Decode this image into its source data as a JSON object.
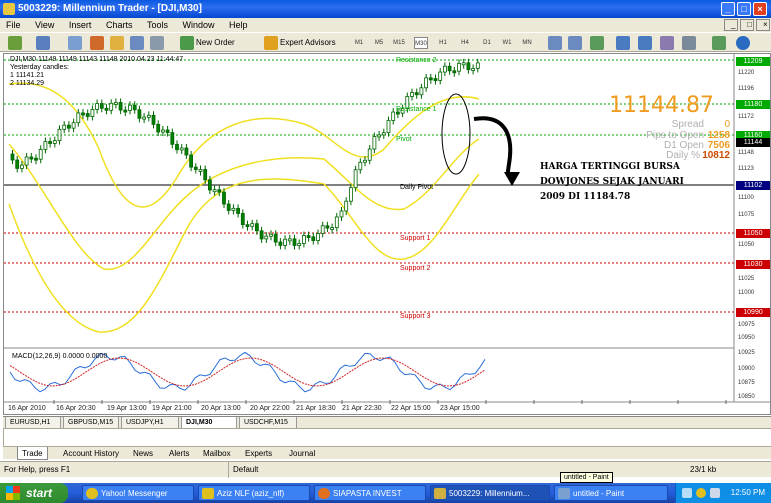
{
  "window": {
    "title": "5003229: Millennium Trader - [DJI,M30]"
  },
  "menu": [
    "File",
    "View",
    "Insert",
    "Charts",
    "Tools",
    "Window",
    "Help"
  ],
  "toolbar": {
    "new_order": "New Order",
    "expert_advisors": "Expert Advisors",
    "timeframes": [
      "M1",
      "M5",
      "M15",
      "M30",
      "H1",
      "H4",
      "D1",
      "W1",
      "MN"
    ]
  },
  "chart": {
    "symbol_line": "DJI,M30 11149 11149 11143 11148  2010.04.23 11:44:47",
    "ohlc_lines": [
      "Yesterday candles:",
      "1 11141.21",
      "2 11134.29"
    ],
    "price_display": "11144.87",
    "spread_label": "Spread",
    "spread_value": "0",
    "pips_label": "Pips to Open",
    "pips_value": "1258",
    "d1_label": "D1 Open",
    "d1_value": "7506",
    "daily_label": "Daily %",
    "daily_value": "10812",
    "annotation": [
      "HARGA TERTINGGI BURSA",
      "DOWJONES SEJAK JANUARI",
      "2009 DI 11184.78"
    ],
    "levels": {
      "resistance2": "Resistance 2",
      "resistance1": "Resistance 1",
      "pivot": "Pivot",
      "daily_pivot": "Daily Pivot",
      "support1": "Support 1",
      "support2": "Support 2",
      "support3": "Support 3"
    },
    "indicator_label": "MACD(12,26,9) 0.0000 0.0000",
    "time_labels": [
      "16 Apr 2010",
      "16 Apr 20:30",
      "19 Apr 13:00",
      "19 Apr 21:00",
      "20 Apr 13:00",
      "20 Apr 22:00",
      "21 Apr 18:30",
      "21 Apr 22:30",
      "22 Apr 15:00",
      "23 Apr 15:00"
    ],
    "price_axis": [
      "11220",
      "11196",
      "11172",
      "11148",
      "11123",
      "11100",
      "11075",
      "11050",
      "11025",
      "11000",
      "10975",
      "10950",
      "10925",
      "10900",
      "10875",
      "10850"
    ],
    "price_tags": [
      {
        "label": "11209",
        "color": "#00aa00"
      },
      {
        "label": "11180",
        "color": "#00aa00"
      },
      {
        "label": "11160",
        "color": "#00aa00"
      },
      {
        "label": "11144",
        "color": "#000000"
      },
      {
        "label": "11102",
        "color": "#000080"
      },
      {
        "label": "11050",
        "color": "#cc0000"
      },
      {
        "label": "11030",
        "color": "#cc0000"
      },
      {
        "label": "10990",
        "color": "#cc0000"
      }
    ]
  },
  "symbol_tabs": [
    "EURUSD,H1",
    "GBPUSD,M15",
    "USDJPY,H1",
    "DJI,M30",
    "USDCHF,M15"
  ],
  "terminal_tabs": [
    "Trade",
    "Account History",
    "News",
    "Alerts",
    "Mailbox",
    "Experts",
    "Journal"
  ],
  "status_bar": {
    "help": "For Help, press F1",
    "profile": "Default",
    "connection": "23/1 kb"
  },
  "taskbar": {
    "start": "start",
    "tasks": [
      "Yahoo! Messenger",
      "Aziz NLF (aziz_nlf)",
      "SIAPASTA INVEST",
      "5003229: Millennium...",
      "untitled - Paint"
    ],
    "tooltip": "untitled - Paint",
    "clock": "12:50 PM"
  }
}
